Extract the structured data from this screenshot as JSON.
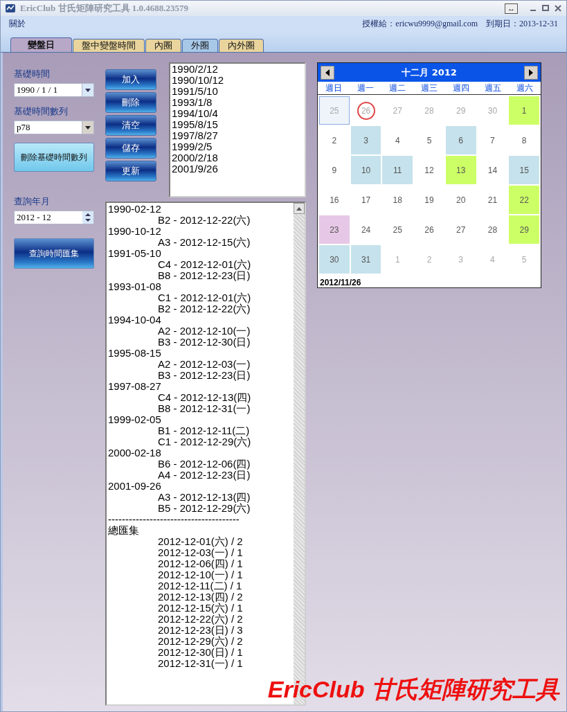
{
  "window": {
    "title": "EricClub 甘氏矩陣研究工具 1.0.4688.23579",
    "extra_button": "↔"
  },
  "menu": {
    "items": [
      "關於"
    ],
    "license": "授權給：ericwu9999@gmail.com",
    "expiry": "到期日：2013-12-31"
  },
  "tabs": [
    {
      "label": "變盤日",
      "selected": true,
      "color": "#b8a8c8"
    },
    {
      "label": "盤中變盤時間",
      "selected": false,
      "color": "#e8d49c"
    },
    {
      "label": "內圈",
      "selected": false,
      "color": "#e8d49c"
    },
    {
      "label": "外圈",
      "selected": false,
      "color": "#a8c8e8"
    },
    {
      "label": "內外圈",
      "selected": false,
      "color": "#e8d49c"
    }
  ],
  "left": {
    "base_time_label": "基礎時間",
    "base_time_value": "1990 / 1 / 1",
    "series_label": "基礎時間數列",
    "series_value": "p78",
    "delete_series_button": "刪除基礎時間數列",
    "query_label": "查詢年月",
    "query_value": "2012 - 12",
    "query_button": "查詢時間匯集"
  },
  "actions": [
    "加入",
    "刪除",
    "清空",
    "儲存",
    "更新"
  ],
  "base_dates": [
    "1990/2/12",
    "1990/10/12",
    "1991/5/10",
    "1993/1/8",
    "1994/10/4",
    "1995/8/15",
    "1997/8/27",
    "1999/2/5",
    "2000/2/18",
    "2001/9/26"
  ],
  "results": {
    "groups": [
      {
        "date": "1990-02-12",
        "hits": [
          "B2 - 2012-12-22(六)"
        ]
      },
      {
        "date": "1990-10-12",
        "hits": [
          "A3 - 2012-12-15(六)"
        ]
      },
      {
        "date": "1991-05-10",
        "hits": [
          "C4 - 2012-12-01(六)",
          "B8 - 2012-12-23(日)"
        ]
      },
      {
        "date": "1993-01-08",
        "hits": [
          "C1 - 2012-12-01(六)",
          "B2 - 2012-12-22(六)"
        ]
      },
      {
        "date": "1994-10-04",
        "hits": [
          "A2 - 2012-12-10(一)",
          "B3 - 2012-12-30(日)"
        ]
      },
      {
        "date": "1995-08-15",
        "hits": [
          "A2 - 2012-12-03(一)",
          "B3 - 2012-12-23(日)"
        ]
      },
      {
        "date": "1997-08-27",
        "hits": [
          "C4 - 2012-12-13(四)",
          "B8 - 2012-12-31(一)"
        ]
      },
      {
        "date": "1999-02-05",
        "hits": [
          "B1 - 2012-12-11(二)",
          "C1 - 2012-12-29(六)"
        ]
      },
      {
        "date": "2000-02-18",
        "hits": [
          "B6 - 2012-12-06(四)",
          "A4 - 2012-12-23(日)"
        ]
      },
      {
        "date": "2001-09-26",
        "hits": [
          "A3 - 2012-12-13(四)",
          "B5 - 2012-12-29(六)"
        ]
      }
    ],
    "separator": "--------------------------------------",
    "summary_title": "總匯集",
    "summary": [
      "2012-12-01(六) / 2",
      "2012-12-03(一) / 1",
      "2012-12-06(四) / 1",
      "2012-12-10(一) / 1",
      "2012-12-11(二) / 1",
      "2012-12-13(四) / 2",
      "2012-12-15(六) / 1",
      "2012-12-22(六) / 2",
      "2012-12-23(日) / 3",
      "2012-12-29(六) / 2",
      "2012-12-30(日) / 1",
      "2012-12-31(一) / 1"
    ]
  },
  "calendar": {
    "title": "十二月 2012",
    "weekdays": [
      "週日",
      "週一",
      "週二",
      "週三",
      "週四",
      "週五",
      "週六"
    ],
    "weeks": [
      [
        {
          "day": "25",
          "muted": true,
          "selected": true
        },
        {
          "day": "26",
          "muted": true,
          "today": true
        },
        {
          "day": "27",
          "muted": true
        },
        {
          "day": "28",
          "muted": true
        },
        {
          "day": "29",
          "muted": true
        },
        {
          "day": "30",
          "muted": true
        },
        {
          "day": "1",
          "color": "#ccff66"
        }
      ],
      [
        {
          "day": "2"
        },
        {
          "day": "3",
          "color": "#c6e2ec"
        },
        {
          "day": "4"
        },
        {
          "day": "5"
        },
        {
          "day": "6",
          "color": "#c6e2ec"
        },
        {
          "day": "7"
        },
        {
          "day": "8"
        }
      ],
      [
        {
          "day": "9"
        },
        {
          "day": "10",
          "color": "#c6e2ec"
        },
        {
          "day": "11",
          "color": "#c6e2ec"
        },
        {
          "day": "12"
        },
        {
          "day": "13",
          "color": "#ccff66"
        },
        {
          "day": "14"
        },
        {
          "day": "15",
          "color": "#c6e2ec"
        }
      ],
      [
        {
          "day": "16"
        },
        {
          "day": "17"
        },
        {
          "day": "18"
        },
        {
          "day": "19"
        },
        {
          "day": "20"
        },
        {
          "day": "21"
        },
        {
          "day": "22",
          "color": "#ccff66"
        }
      ],
      [
        {
          "day": "23",
          "color": "#e6c8e6"
        },
        {
          "day": "24"
        },
        {
          "day": "25"
        },
        {
          "day": "26"
        },
        {
          "day": "27"
        },
        {
          "day": "28"
        },
        {
          "day": "29",
          "color": "#ccff66"
        }
      ],
      [
        {
          "day": "30",
          "color": "#c6e2ec"
        },
        {
          "day": "31",
          "color": "#c6e2ec"
        },
        {
          "day": "1",
          "muted": true
        },
        {
          "day": "2",
          "muted": true
        },
        {
          "day": "3",
          "muted": true
        },
        {
          "day": "4",
          "muted": true
        },
        {
          "day": "5",
          "muted": true
        }
      ]
    ],
    "today_label": "2012/11/26"
  },
  "banner": "EricClub 甘氏矩陣研究工具"
}
